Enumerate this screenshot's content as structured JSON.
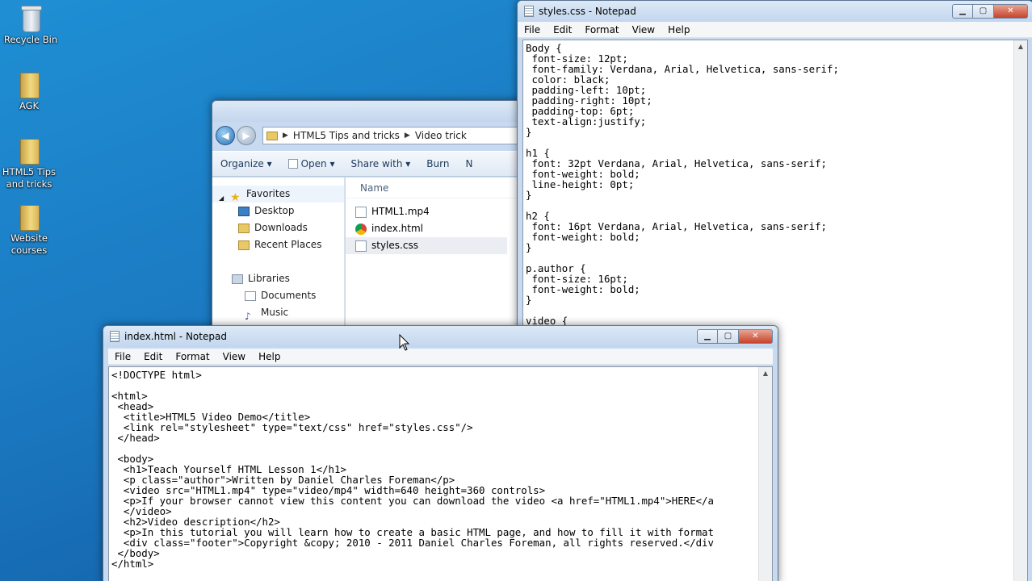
{
  "desktop": {
    "icons": [
      {
        "label": "Recycle Bin"
      },
      {
        "label": "AGK"
      },
      {
        "label": "HTML5 Tips and tricks"
      },
      {
        "label": "Website courses"
      }
    ]
  },
  "css_notepad": {
    "title": "styles.css - Notepad",
    "menu": [
      "File",
      "Edit",
      "Format",
      "View",
      "Help"
    ],
    "content": "Body {\n font-size: 12pt;\n font-family: Verdana, Arial, Helvetica, sans-serif;\n color: black;\n padding-left: 10pt;\n padding-right: 10pt;\n padding-top: 6pt;\n text-align:justify;\n}\n\nh1 {\n font: 32pt Verdana, Arial, Helvetica, sans-serif;\n font-weight: bold;\n line-height: 0pt;\n}\n\nh2 {\n font: 16pt Verdana, Arial, Helvetica, sans-serif;\n font-weight: bold;\n}\n\np.author {\n font-size: 16pt;\n font-weight: bold;\n}\n\nvideo {"
  },
  "explorer": {
    "breadcrumb": [
      "HTML5 Tips and tricks",
      "Video trick"
    ],
    "commands": [
      "Organize",
      "Open",
      "Share with",
      "Burn",
      "N"
    ],
    "nav": {
      "favorites_label": "Favorites",
      "favorites": [
        "Desktop",
        "Downloads",
        "Recent Places"
      ],
      "libraries_label": "Libraries",
      "libraries": [
        "Documents",
        "Music"
      ]
    },
    "column_name": "Name",
    "files": [
      "HTML1.mp4",
      "index.html",
      "styles.css"
    ]
  },
  "html_notepad": {
    "title": "index.html - Notepad",
    "menu": [
      "File",
      "Edit",
      "Format",
      "View",
      "Help"
    ],
    "content": "<!DOCTYPE html>\n\n<html>\n <head>\n  <title>HTML5 Video Demo</title>\n  <link rel=\"stylesheet\" type=\"text/css\" href=\"styles.css\"/>\n </head>\n\n <body>\n  <h1>Teach Yourself HTML Lesson 1</h1>\n  <p class=\"author\">Written by Daniel Charles Foreman</p>\n  <video src=\"HTML1.mp4\" type=\"video/mp4\" width=640 height=360 controls>\n  <p>If your browser cannot view this content you can download the video <a href=\"HTML1.mp4\">HERE</a\n  </video>\n  <h2>Video description</h2>\n  <p>In this tutorial you will learn how to create a basic HTML page, and how to fill it with format\n  <div class=\"footer\">Copyright &copy; 2010 - 2011 Daniel Charles Foreman, all rights reserved.</div\n </body>\n</html>"
  }
}
